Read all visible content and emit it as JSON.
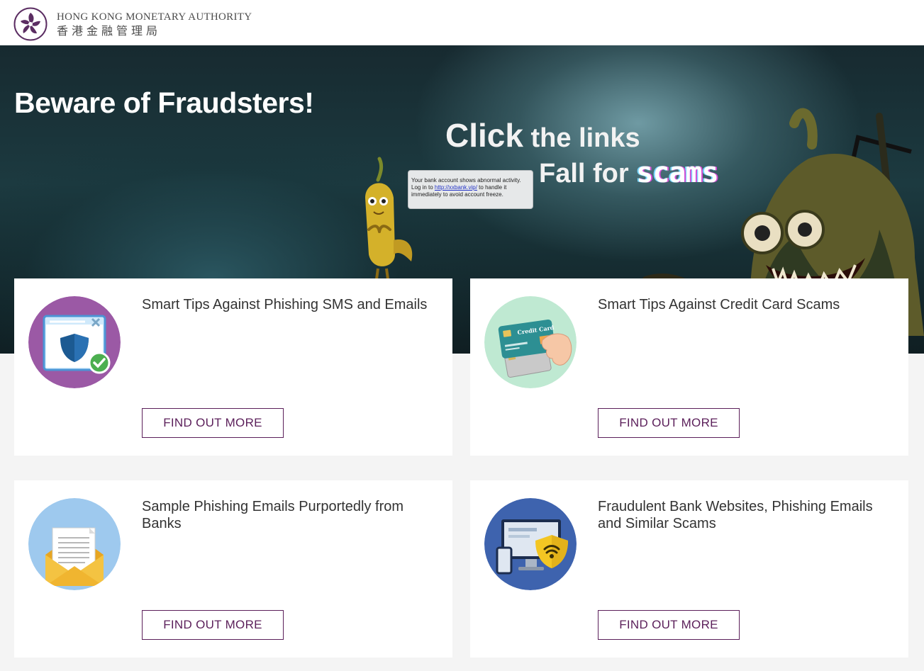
{
  "header": {
    "org_name_en": "HONG KONG MONETARY AUTHORITY",
    "org_name_zh": "香港金融管理局",
    "logo_icon": "bauhinia-logo-icon"
  },
  "hero": {
    "title": "Beware of Fraudsters!",
    "line1_word1": "Click",
    "line1_rest": " the links",
    "line2_word": "Fall for ",
    "line2_scam": "scams",
    "bubble": {
      "line1": "Your bank account shows abnormal activity.",
      "line2_pre": "Log in to ",
      "line2_link": "http://xxbank.vip/",
      "line2_post": " to handle it",
      "line3": "immediately to avoid account freeze."
    }
  },
  "cards": [
    {
      "title": "Smart Tips Against Phishing SMS and Emails",
      "button": "FIND OUT MORE",
      "icon": "shield-browser-icon",
      "icon_bg": "#9b59a5"
    },
    {
      "title": "Smart Tips Against Credit Card Scams",
      "button": "FIND OUT MORE",
      "icon": "credit-card-icon",
      "icon_bg": "#bfe9d2",
      "card_label": "Credit Card"
    },
    {
      "title": "Sample Phishing Emails Purportedly from Banks",
      "button": "FIND OUT MORE",
      "icon": "email-envelope-icon",
      "icon_bg": "#9ec9ee"
    },
    {
      "title": "Fraudulent Bank Websites, Phishing Emails and Similar Scams",
      "button": "FIND OUT MORE",
      "icon": "devices-wifi-shield-icon",
      "icon_bg": "#3e63ae"
    }
  ],
  "colors": {
    "accent": "#5b1f5a",
    "card_bg": "#ffffff",
    "page_bg": "#f4f4f4"
  }
}
